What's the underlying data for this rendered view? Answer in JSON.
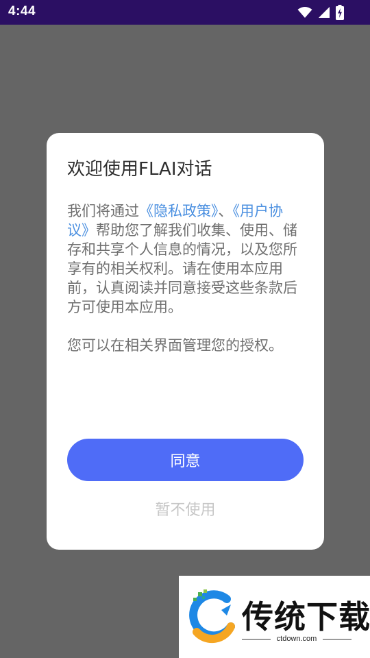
{
  "status_bar": {
    "time": "4:44",
    "icons": [
      "wifi-icon",
      "cellular-signal-icon",
      "battery-charging-icon"
    ]
  },
  "dialog": {
    "title": "欢迎使用FLAI对话",
    "body": {
      "intro": "我们将通过",
      "privacy_link": "《隐私政策》",
      "separator": "、",
      "user_agreement_link": "《用户协议》",
      "rest": "帮助您了解我们收集、使用、储存和共享个人信息的情况，以及您所享有的相关权利。请在使用本应用前，认真阅读并同意接受这些条款后方可使用本应用。",
      "second_paragraph": "您可以在相关界面管理您的授权。"
    },
    "agree_label": "同意",
    "decline_label": "暂不使用"
  },
  "watermark": {
    "brand": "传统下载",
    "domain": "ctdown.com"
  },
  "colors": {
    "status_bar": "#2b0f63",
    "overlay": "#656565",
    "link": "#4a8fe0",
    "primary_button": "#4f6cf7"
  }
}
